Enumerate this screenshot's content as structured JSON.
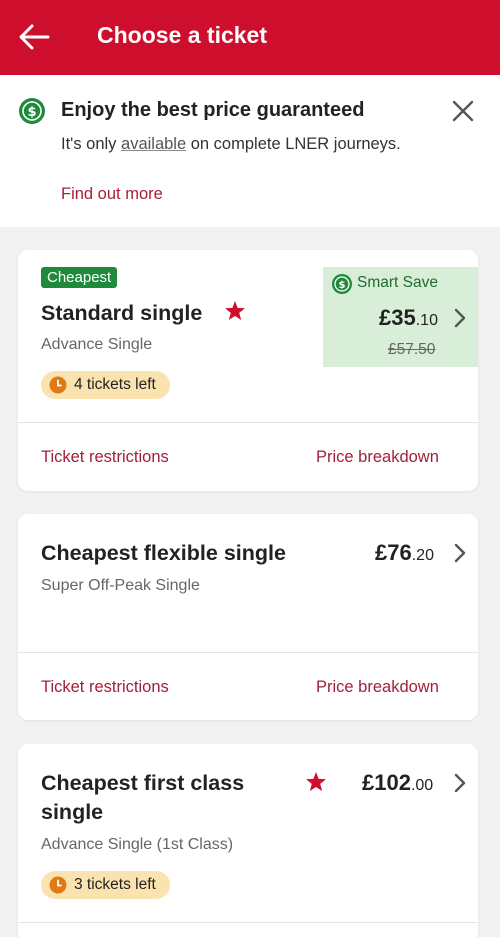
{
  "header": {
    "title": "Choose a ticket"
  },
  "banner": {
    "title": "Enjoy the best price guaranteed",
    "text_before": "It's only ",
    "text_link": "available",
    "text_after": " on complete LNER journeys.",
    "find_out_more": "Find out more"
  },
  "tickets": [
    {
      "badge": "Cheapest",
      "title": "Standard single",
      "subtitle": "Advance Single",
      "tickets_left": "4 tickets left",
      "smart_save_label": "Smart Save",
      "price_pounds": "£35",
      "price_pence": ".10",
      "old_price": "£57.50",
      "restrictions": "Ticket restrictions",
      "breakdown": "Price breakdown"
    },
    {
      "title": "Cheapest flexible single",
      "subtitle": "Super Off-Peak Single",
      "price_pounds": "£76",
      "price_pence": ".20",
      "restrictions": "Ticket restrictions",
      "breakdown": "Price breakdown"
    },
    {
      "title_line1": "Cheapest first class",
      "title_line2": "single",
      "subtitle": "Advance Single (1st Class)",
      "tickets_left": "3 tickets left",
      "price_pounds": "£102",
      "price_pence": ".00"
    }
  ],
  "colors": {
    "brand_red": "#ce0e2d",
    "link_red": "#a3203a",
    "save_green": "#1f8a3c",
    "warning_amber": "#fbe3b0"
  }
}
